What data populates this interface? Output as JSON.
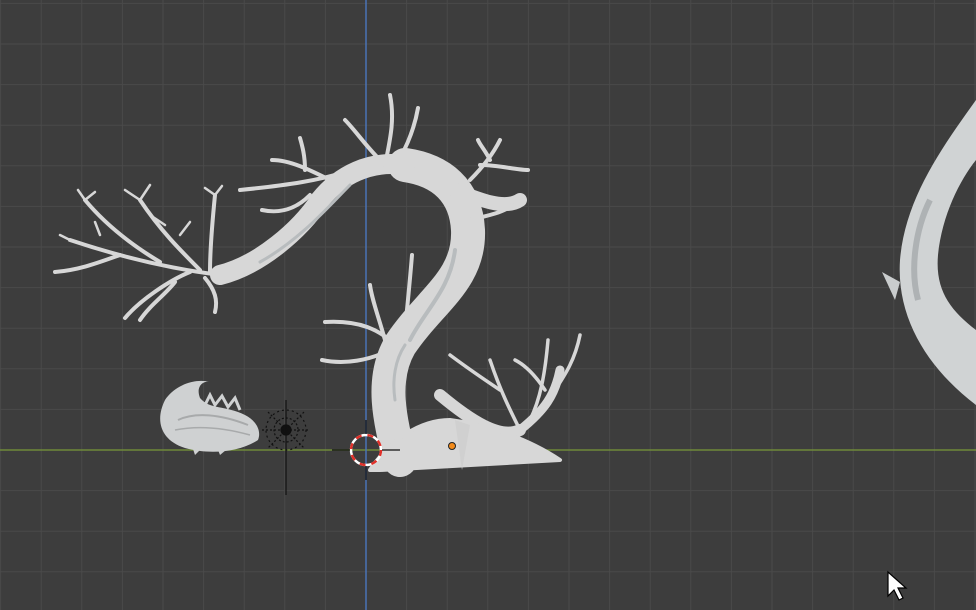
{
  "viewport": {
    "view": "front-orthographic",
    "grid_visible": true,
    "colors": {
      "background": "#3d3d3d",
      "grid_line": "#4a4a4a",
      "x_axis": "#6f8a3a",
      "z_axis": "#4a73b5",
      "model": "#d7d7d7",
      "model_shadow": "#aeb2b4",
      "cursor_red": "#e0312a",
      "origin": "#f28a1a"
    },
    "objects": [
      {
        "id": "tree",
        "label_icon": "tree-mesh"
      },
      {
        "id": "dragon",
        "label_icon": "dragon-mesh"
      },
      {
        "id": "light",
        "label_icon": "sun-lamp-icon"
      },
      {
        "id": "wave-sculpt",
        "label_icon": "curve-mesh"
      }
    ],
    "cursor_icon": "mouse-pointer-icon",
    "cursor_3d_icon": "3d-cursor-icon"
  }
}
